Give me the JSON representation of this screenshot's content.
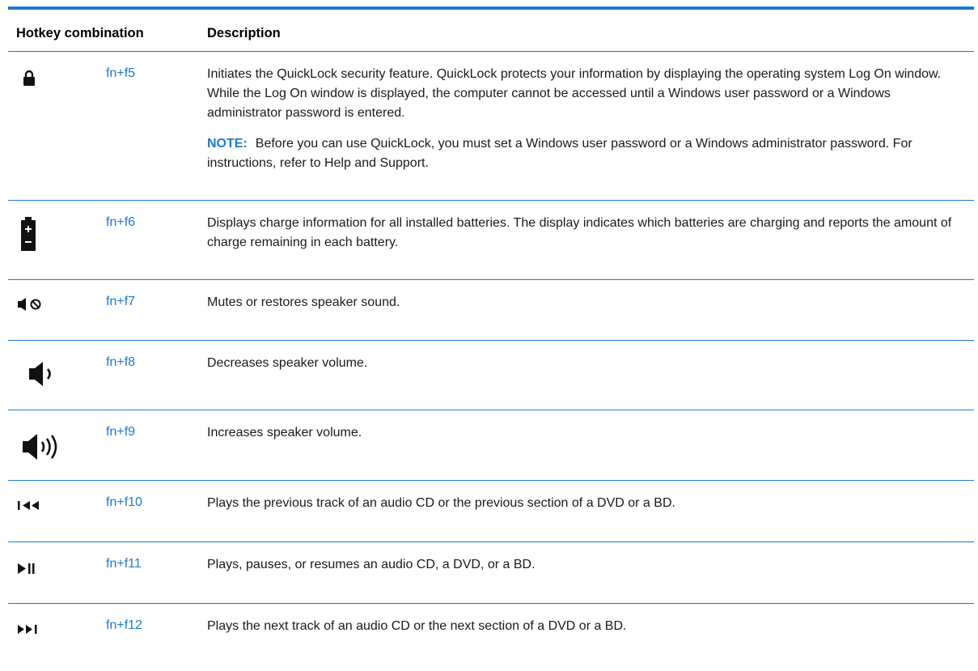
{
  "table": {
    "header": {
      "hotkey_label": "Hotkey combination",
      "description_label": "Description"
    },
    "rows": [
      {
        "icon": "lock-icon",
        "key": "fn+f5",
        "description": "Initiates the QuickLock security feature. QuickLock protects your information by displaying the operating system Log On window. While the Log On window is displayed, the computer cannot be accessed until a Windows user password or a Windows administrator password is entered.",
        "note_label": "NOTE:",
        "note_text": "Before you can use QuickLock, you must set a Windows user password or a Windows administrator password. For instructions, refer to Help and Support."
      },
      {
        "icon": "battery-icon",
        "key": "fn+f6",
        "description": "Displays charge information for all installed batteries. The display indicates which batteries are charging and reports the amount of charge remaining in each battery."
      },
      {
        "icon": "speaker-mute-icon",
        "key": "fn+f7",
        "description": "Mutes or restores speaker sound."
      },
      {
        "icon": "volume-down-icon",
        "key": "fn+f8",
        "description": "Decreases speaker volume."
      },
      {
        "icon": "volume-up-icon",
        "key": "fn+f9",
        "description": "Increases speaker volume."
      },
      {
        "icon": "previous-track-icon",
        "key": "fn+f10",
        "description": "Plays the previous track of an audio CD or the previous section of a DVD or a BD."
      },
      {
        "icon": "play-pause-icon",
        "key": "fn+f11",
        "description": "Plays, pauses, or resumes an audio CD, a DVD, or a BD."
      },
      {
        "icon": "next-track-icon",
        "key": "fn+f12",
        "description": "Plays the next track of an audio CD or the next section of a DVD or a BD."
      }
    ]
  },
  "colors": {
    "accent": "#1a7ad4",
    "text": "#1a1a1a"
  }
}
